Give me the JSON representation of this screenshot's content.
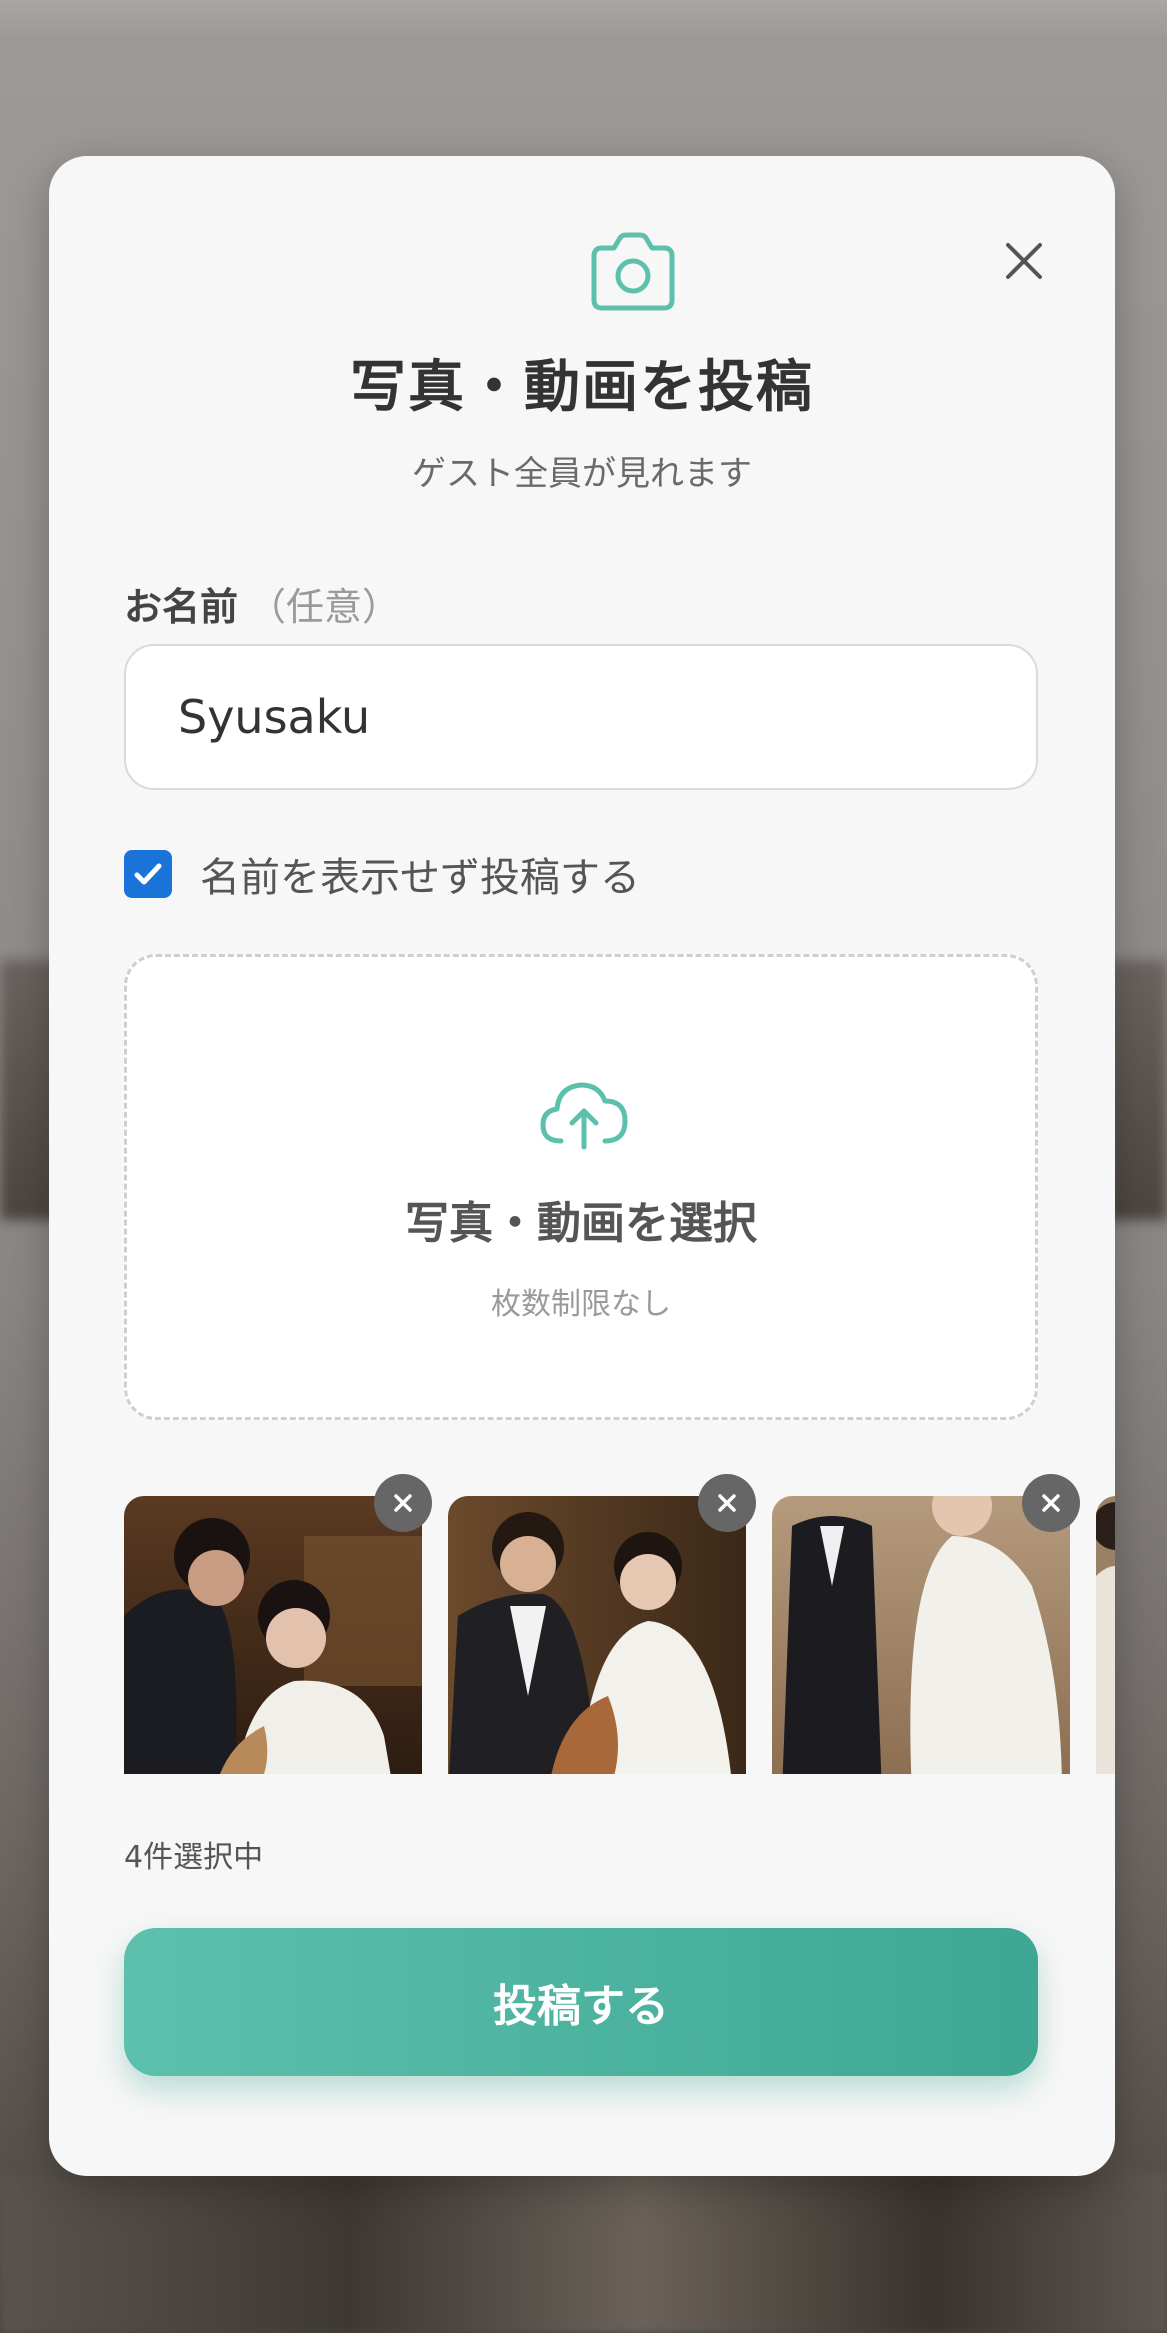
{
  "modal": {
    "title": "写真・動画を投稿",
    "subtitle": "ゲスト全員が見れます"
  },
  "name_field": {
    "label": "お名前",
    "optional_label": "（任意）",
    "value": "Syusaku"
  },
  "anonymous_option": {
    "label": "名前を表示せず投稿する",
    "checked": true
  },
  "dropzone": {
    "title": "写真・動画を選択",
    "subtitle": "枚数制限なし"
  },
  "selection": {
    "count_text": "4件選択中"
  },
  "submit_button": {
    "label": "投稿する"
  },
  "icons": {
    "top": "camera-icon",
    "close": "close-icon",
    "upload": "cloud-upload-icon",
    "remove": "remove-icon"
  },
  "colors": {
    "accent": "#5cc0ad",
    "checkbox": "#1a73d9"
  }
}
